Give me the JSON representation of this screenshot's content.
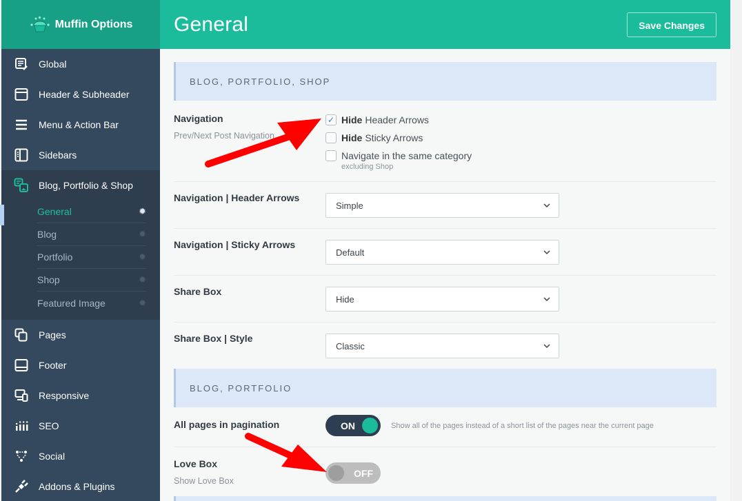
{
  "app": {
    "logo_text": "Muffin Options",
    "accent_color": "#1bbc9b",
    "sidebar_color": "#34495e"
  },
  "sidebar": {
    "items": [
      {
        "label": "Global",
        "icon": "edit-document-icon"
      },
      {
        "label": "Header & Subheader",
        "icon": "window-icon"
      },
      {
        "label": "Menu & Action Bar",
        "icon": "menu-icon"
      },
      {
        "label": "Sidebars",
        "icon": "sidebar-icon"
      },
      {
        "label": "Blog, Portfolio & Shop",
        "icon": "blog-portfolio-icon",
        "active": true
      },
      {
        "label": "Pages",
        "icon": "pages-icon"
      },
      {
        "label": "Footer",
        "icon": "footer-icon"
      },
      {
        "label": "Responsive",
        "icon": "responsive-icon"
      },
      {
        "label": "SEO",
        "icon": "seo-icon"
      },
      {
        "label": "Social",
        "icon": "social-icon"
      },
      {
        "label": "Addons & Plugins",
        "icon": "plug-icon"
      }
    ],
    "submenu": [
      {
        "label": "General",
        "current": true
      },
      {
        "label": "Blog"
      },
      {
        "label": "Portfolio"
      },
      {
        "label": "Shop"
      },
      {
        "label": "Featured Image"
      }
    ]
  },
  "header": {
    "title": "General",
    "save_label": "Save Changes"
  },
  "sections": [
    {
      "heading": "BLOG, PORTFOLIO, SHOP",
      "navigation": {
        "title": "Navigation",
        "desc": "Prev/Next Post Navigation",
        "options": [
          {
            "bold": "Hide",
            "label": "Header Arrows",
            "checked": true
          },
          {
            "bold": "Hide",
            "label": "Sticky Arrows",
            "checked": false
          },
          {
            "bold": "",
            "label": "Navigate in the same category",
            "checked": false,
            "note": "excluding Shop"
          }
        ]
      },
      "selects": [
        {
          "title": "Navigation | Header Arrows",
          "value": "Simple"
        },
        {
          "title": "Navigation | Sticky Arrows",
          "value": "Default"
        },
        {
          "title": "Share Box",
          "value": "Hide"
        },
        {
          "title": "Share Box | Style",
          "value": "Classic"
        }
      ]
    },
    {
      "heading": "BLOG, PORTFOLIO",
      "toggles": [
        {
          "title": "All pages in pagination",
          "desc": "",
          "state": "ON",
          "on": true,
          "note": "Show all of the pages instead of a short list of the pages near the current page"
        },
        {
          "title": "Love Box",
          "desc": "Show Love Box",
          "state": "OFF",
          "on": false,
          "note": ""
        }
      ]
    }
  ]
}
